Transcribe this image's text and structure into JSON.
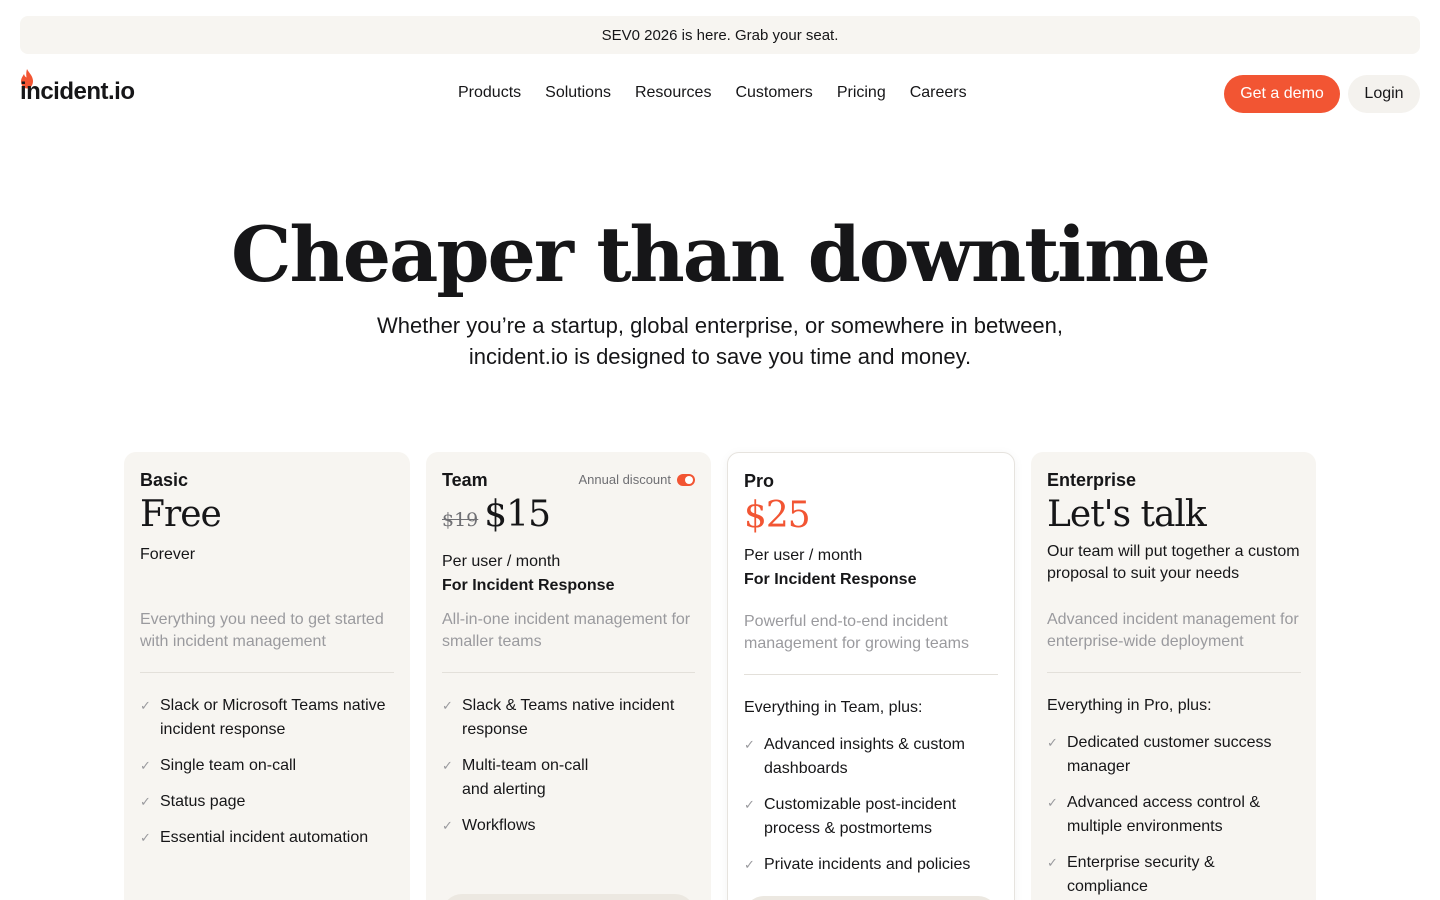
{
  "banner": {
    "text": "SEV0 2026 is here. Grab your seat."
  },
  "nav": {
    "logo": "incident.io",
    "links": [
      "Products",
      "Solutions",
      "Resources",
      "Customers",
      "Pricing",
      "Careers"
    ],
    "demo_label": "Get a demo",
    "login_label": "Login"
  },
  "hero": {
    "title": "Cheaper than downtime",
    "subtitle_line1": "Whether you’re a startup, global enterprise, or somewhere in between,",
    "subtitle_line2": "incident.io is designed to save you time and money."
  },
  "colors": {
    "accent": "#f25533",
    "card_bg": "#f7f5f1",
    "muted": "#9a9a9e"
  },
  "plans": [
    {
      "name": "Basic",
      "price": "Free",
      "period": "Forever",
      "description": "Everything you need to get started with incident management",
      "features": [
        "Slack or Microsoft Teams native incident response",
        "Single team on-call",
        "Status page",
        "Essential incident automation"
      ]
    },
    {
      "name": "Team",
      "discount_label": "Annual discount",
      "old_price": "$19",
      "price": "$15",
      "period": "Per user / month",
      "focus": "For Incident Response",
      "description": "All-in-one incident management for smaller teams",
      "features": [
        "Slack & Teams native incident response",
        "Multi-team on-call and alerting",
        "Workflows"
      ]
    },
    {
      "name": "Pro",
      "price": "$25",
      "period": "Per user / month",
      "focus": "For Incident Response",
      "description": "Powerful end-to-end incident management for growing teams",
      "plus": "Everything in Team, plus:",
      "features": [
        "Advanced insights & custom dashboards",
        "Customizable post-incident process & postmortems",
        "Private incidents and policies"
      ]
    },
    {
      "name": "Enterprise",
      "price": "Let's talk",
      "period": "Our team will put together a custom proposal to suit your needs",
      "description": "Advanced incident management for enterprise-wide deployment",
      "plus": "Everything in Pro, plus:",
      "features": [
        "Dedicated customer success manager",
        "Advanced access control & multiple environments",
        "Enterprise security & compliance"
      ]
    }
  ]
}
